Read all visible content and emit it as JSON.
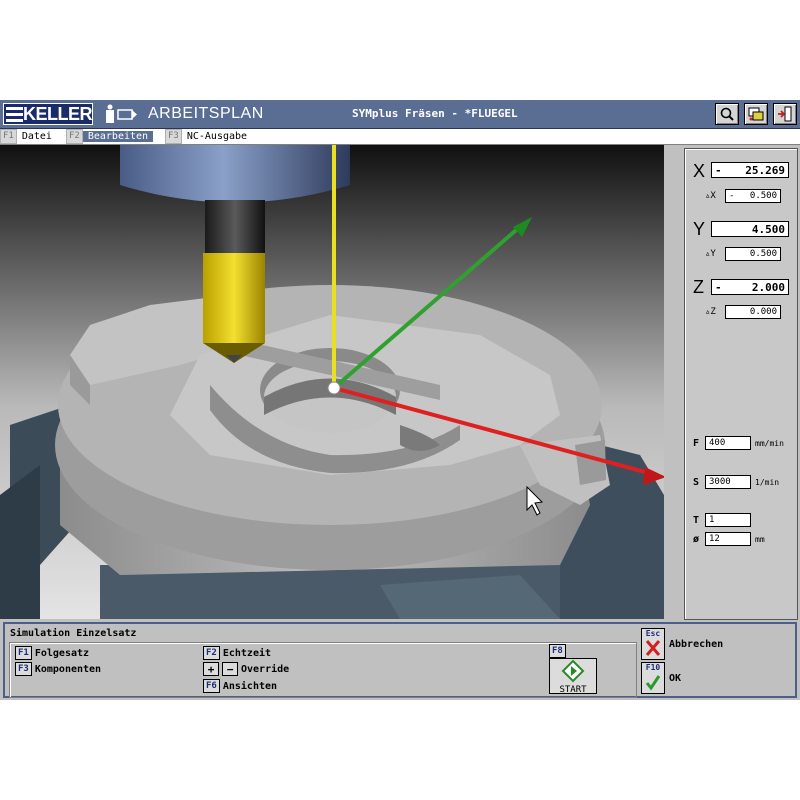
{
  "titlebar": {
    "logo": "KELLER",
    "app_title": "ARBEITSPLAN",
    "doc_title": "SYMplus Fräsen - *FLUEGEL",
    "buttons": [
      "magnifier-icon",
      "settings-icon",
      "exit-icon"
    ]
  },
  "menu": [
    {
      "key": "F1",
      "label": "Datei",
      "active": false
    },
    {
      "key": "F2",
      "label": "Bearbeiten",
      "active": true
    },
    {
      "key": "F3",
      "label": "NC-Ausgabe",
      "active": false
    }
  ],
  "coords": {
    "x": {
      "axis": "X",
      "sign": "-",
      "value": "25.269",
      "delta_label": "▵X",
      "delta_sign": "-",
      "delta": "0.500"
    },
    "y": {
      "axis": "Y",
      "sign": "",
      "value": "4.500",
      "delta_label": "▵Y",
      "delta_sign": "",
      "delta": "0.500"
    },
    "z": {
      "axis": "Z",
      "sign": "-",
      "value": "2.000",
      "delta_label": "▵Z",
      "delta_sign": "",
      "delta": "0.000"
    }
  },
  "params": {
    "f": {
      "label": "F",
      "value": "400",
      "unit": "mm/min"
    },
    "s": {
      "label": "S",
      "value": "3000",
      "unit": "1/min"
    },
    "t": {
      "label": "T",
      "value": "1",
      "unit": ""
    },
    "d": {
      "label": "ø",
      "value": "12",
      "unit": "mm"
    }
  },
  "simulation": {
    "title": "Simulation Einzelsatz",
    "keys": [
      {
        "key": "F1",
        "label": "Folgesatz"
      },
      {
        "key": "F3",
        "label": "Komponenten"
      },
      {
        "key": "F2",
        "label": "Echtzeit"
      },
      {
        "key": "+/-",
        "label": "Override",
        "plus": "+",
        "minus": "−"
      },
      {
        "key": "F6",
        "label": "Ansichten"
      }
    ],
    "start": {
      "key": "F8",
      "label": "START"
    },
    "cancel": {
      "key": "Esc",
      "label": "Abbrechen"
    },
    "ok": {
      "key": "F10",
      "label": "OK"
    }
  },
  "colors": {
    "accent": "#5a6e93",
    "axis_x": "#e02020",
    "axis_y": "#30a030",
    "axis_z": "#e8e020",
    "workpiece": "#a8a8a8",
    "fixture": "#3e4e5c"
  }
}
